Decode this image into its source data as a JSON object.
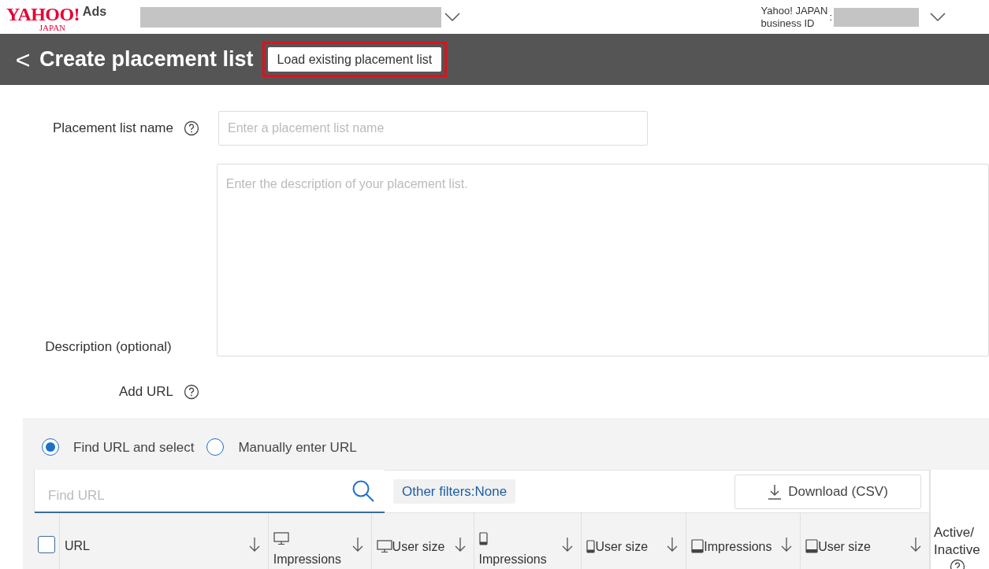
{
  "header": {
    "logo_main": "YAHOO!",
    "logo_sub": "JAPAN",
    "logo_product": "Ads",
    "business_id_label_line1": "Yahoo! JAPAN",
    "business_id_label_line2": "business ID",
    "business_id_separator": ":"
  },
  "title_bar": {
    "back": "<",
    "title": "Create placement list",
    "load_button": "Load existing placement list",
    "highlighted": true
  },
  "form": {
    "name_label": "Placement list name",
    "name_placeholder": "Enter a placement list name",
    "description_label": "Description (optional)",
    "description_placeholder": "Enter the description of your placement list.",
    "add_url_label": "Add URL"
  },
  "modes": [
    {
      "label": "Find URL and select",
      "selected": true
    },
    {
      "label": "Manually enter URL",
      "selected": false
    }
  ],
  "search": {
    "placeholder": "Find URL"
  },
  "filters": "Other filters:None",
  "download_button": "Download (CSV)",
  "table": {
    "select_all_checked": false,
    "columns": [
      {
        "label": "URL",
        "kind": "plain",
        "stacked": false
      },
      {
        "label": "Impressions",
        "kind": "desktop",
        "stacked": true
      },
      {
        "label": "User size",
        "kind": "desktop",
        "stacked": false
      },
      {
        "label": "Impressions",
        "kind": "phone",
        "stacked": true
      },
      {
        "label": "User size",
        "kind": "phone",
        "stacked": false
      },
      {
        "label": "Impressions",
        "kind": "tablet",
        "stacked": false
      },
      {
        "label": "User size",
        "kind": "tablet",
        "stacked": false
      }
    ],
    "status_column": {
      "line1": "Active/",
      "line2": "Inactive"
    }
  }
}
